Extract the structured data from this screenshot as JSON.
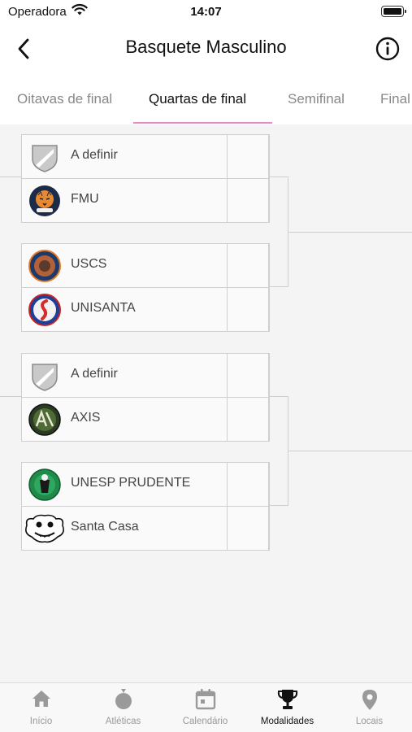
{
  "status_bar": {
    "carrier": "Operadora",
    "time": "14:07"
  },
  "header": {
    "title": "Basquete Masculino"
  },
  "tabs": [
    {
      "label": "Oitavas de final"
    },
    {
      "label": "Quartas de final"
    },
    {
      "label": "Semifinal"
    },
    {
      "label": "Final"
    }
  ],
  "matches": [
    {
      "teams": [
        {
          "name": "A definir",
          "logo": "placeholder-shield-icon"
        },
        {
          "name": "FMU",
          "logo": "tiger-logo"
        }
      ]
    },
    {
      "teams": [
        {
          "name": "USCS",
          "logo": "uscs-logo"
        },
        {
          "name": "UNISANTA",
          "logo": "seahorse-logo"
        }
      ]
    },
    {
      "teams": [
        {
          "name": "A definir",
          "logo": "placeholder-shield-icon"
        },
        {
          "name": "AXIS",
          "logo": "axis-logo"
        }
      ]
    },
    {
      "teams": [
        {
          "name": "UNESP PRUDENTE",
          "logo": "unesp-logo"
        },
        {
          "name": "Santa Casa",
          "logo": "mascot-logo"
        }
      ]
    }
  ],
  "tabbar": [
    {
      "label": "Início",
      "icon": "home-icon"
    },
    {
      "label": "Atléticas",
      "icon": "medal-icon"
    },
    {
      "label": "Calendário",
      "icon": "calendar-icon"
    },
    {
      "label": "Modalidades",
      "icon": "trophy-icon"
    },
    {
      "label": "Locais",
      "icon": "location-pin-icon"
    }
  ],
  "colors": {
    "accent": "#e58bc3",
    "active_text": "#111111",
    "inactive_text": "#999999"
  }
}
